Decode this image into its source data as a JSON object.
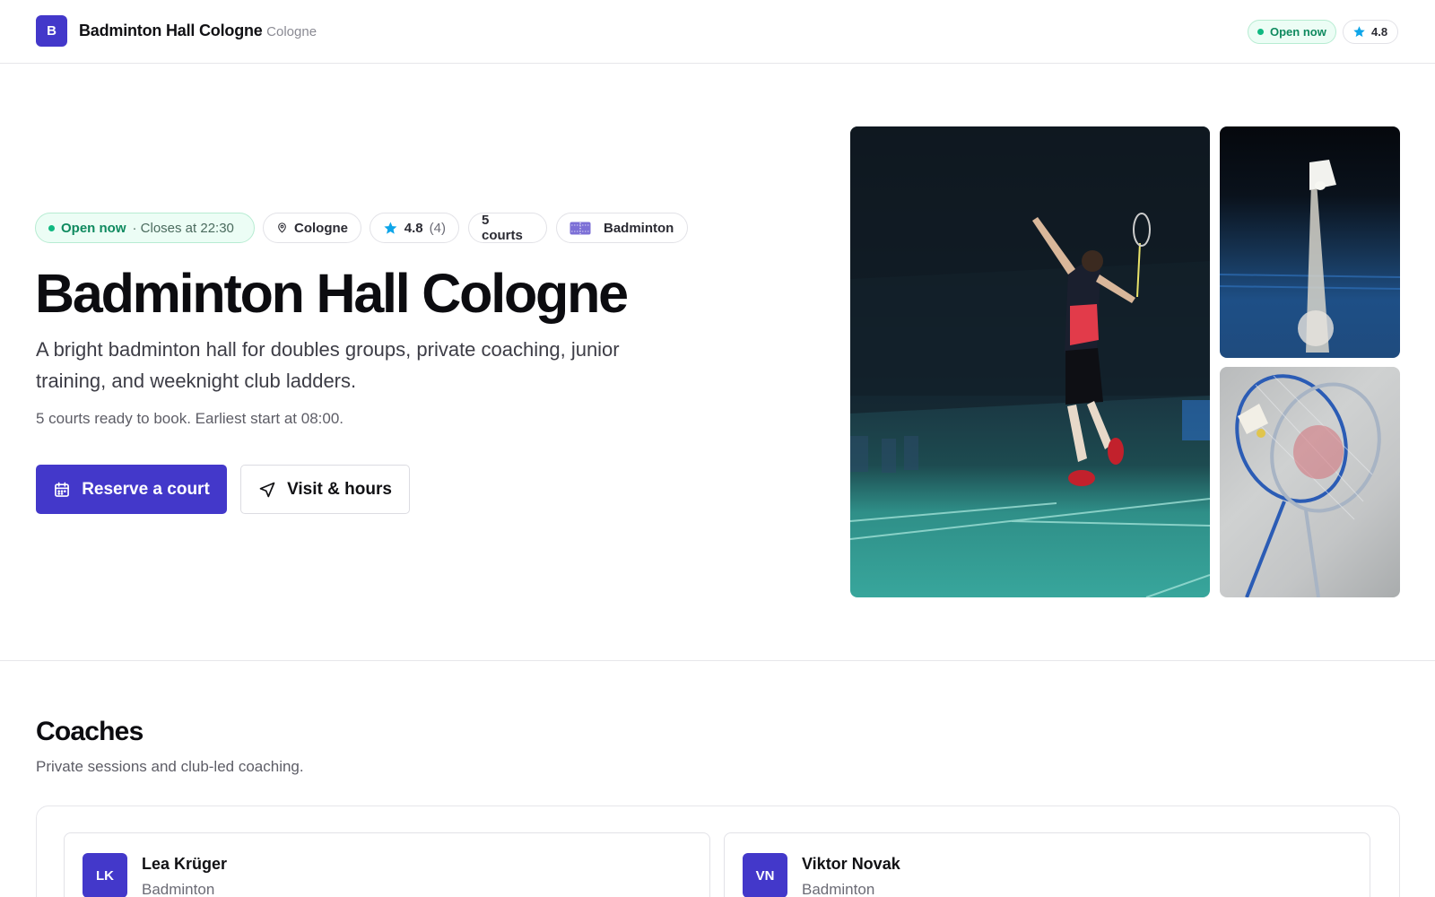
{
  "header": {
    "logo_letter": "B",
    "venue_name": "Badminton Hall Cologne",
    "city_suffix": "· Cologne",
    "open_label": "Open now",
    "rating": "4.8"
  },
  "hero": {
    "open_label": "Open now",
    "closes_label": "· Closes at 22:30",
    "city": "Cologne",
    "rating": "4.8",
    "review_count": "(4)",
    "courts": "5 courts",
    "sport": "Badminton",
    "title": "Badminton Hall Cologne",
    "description": "A bright badminton hall for doubles groups, private coaching, junior training, and weeknight club ladders.",
    "meta": "5 courts ready to book. Earliest start at 08:00.",
    "primary_button": "Reserve a court",
    "secondary_button": "Visit & hours"
  },
  "gallery": {
    "images": [
      {
        "subject": "badminton player jumping for a smash"
      },
      {
        "subject": "shuttlecock in flight over court"
      },
      {
        "subject": "two rackets and shuttlecock on concrete"
      }
    ]
  },
  "coaches": {
    "title": "Coaches",
    "subtitle": "Private sessions and club-led coaching.",
    "items": [
      {
        "initials": "LK",
        "name": "Lea Krüger",
        "sport": "Badminton"
      },
      {
        "initials": "VN",
        "name": "Viktor Novak",
        "sport": "Badminton"
      }
    ]
  },
  "colors": {
    "accent": "#4338ca",
    "open_green": "#10b981",
    "star": "#0ea5e9"
  }
}
